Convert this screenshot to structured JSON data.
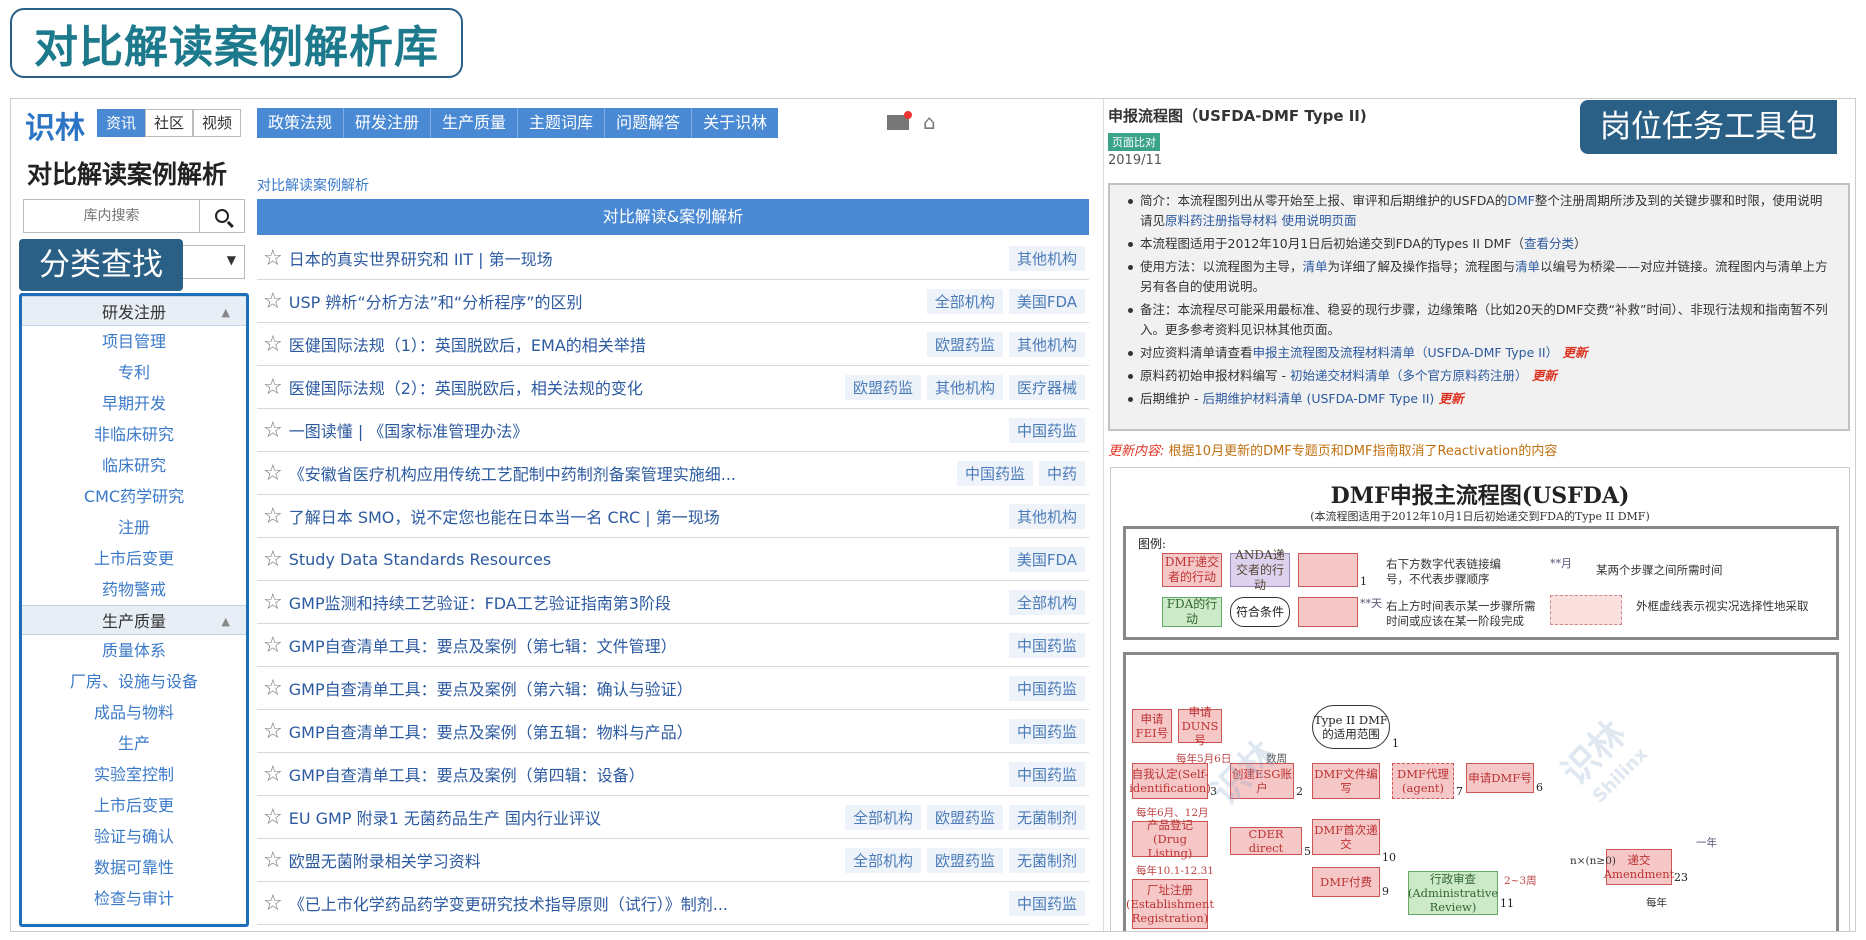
{
  "banner": {
    "title": "对比解读案例解析库"
  },
  "site": {
    "logo": "识林",
    "top_tabs": [
      "资讯",
      "社区",
      "视频"
    ],
    "nav": [
      "政策法规",
      "研发注册",
      "生产质量",
      "主题词库",
      "问题解答",
      "关于识林"
    ]
  },
  "sidebar": {
    "title": "对比解读案例解析",
    "search_placeholder": "库内搜索",
    "tag_label": "分类查找",
    "groups": [
      {
        "title": "研发注册",
        "items": [
          "项目管理",
          "专利",
          "早期开发",
          "非临床研究",
          "临床研究",
          "CMC药学研究",
          "注册",
          "上市后变更",
          "药物警戒"
        ]
      },
      {
        "title": "生产质量",
        "items": [
          "质量体系",
          "厂房、设施与设备",
          "成品与物料",
          "生产",
          "实验室控制",
          "上市后变更",
          "验证与确认",
          "数据可靠性",
          "检查与审计"
        ]
      }
    ]
  },
  "main": {
    "breadcrumb": "对比解读案例解析",
    "header": "对比解读&案例解析",
    "rows": [
      {
        "title": "日本的真实世界研究和 IIT | 第一现场",
        "tags": [
          "其他机构"
        ]
      },
      {
        "title": "USP 辨析“分析方法”和“分析程序”的区别",
        "tags": [
          "全部机构",
          "美国FDA"
        ]
      },
      {
        "title": "医健国际法规（1）：英国脱欧后，EMA的相关举措",
        "tags": [
          "欧盟药监",
          "其他机构"
        ]
      },
      {
        "title": "医健国际法规（2）：英国脱欧后，相关法规的变化",
        "tags": [
          "欧盟药监",
          "其他机构",
          "医疗器械"
        ]
      },
      {
        "title": "一图读懂 | 《国家标准管理办法》",
        "tags": [
          "中国药监"
        ]
      },
      {
        "title": "《安徽省医疗机构应用传统工艺配制中药制剂备案管理实施细...",
        "tags": [
          "中国药监",
          "中药"
        ]
      },
      {
        "title": "了解日本 SMO，说不定您也能在日本当一名 CRC | 第一现场",
        "tags": [
          "其他机构"
        ]
      },
      {
        "title": "Study Data Standards Resources",
        "tags": [
          "美国FDA"
        ]
      },
      {
        "title": "GMP监测和持续工艺验证：FDA工艺验证指南第3阶段",
        "tags": [
          "全部机构"
        ]
      },
      {
        "title": "GMP自查清单工具：要点及案例（第七辑：文件管理）",
        "tags": [
          "中国药监"
        ]
      },
      {
        "title": "GMP自查清单工具：要点及案例（第六辑：确认与验证）",
        "tags": [
          "中国药监"
        ]
      },
      {
        "title": "GMP自查清单工具：要点及案例（第五辑：物料与产品）",
        "tags": [
          "中国药监"
        ]
      },
      {
        "title": "GMP自查清单工具：要点及案例（第四辑：设备）",
        "tags": [
          "中国药监"
        ]
      },
      {
        "title": "EU GMP 附录1 无菌药品生产 国内行业评议",
        "tags": [
          "全部机构",
          "欧盟药监",
          "无菌制剂"
        ]
      },
      {
        "title": "欧盟无菌附录相关学习资料",
        "tags": [
          "全部机构",
          "欧盟药监",
          "无菌制剂"
        ]
      },
      {
        "title": "《已上市化学药品药学变更研究技术指导原则（试行）》制剂...",
        "tags": [
          "中国药监"
        ]
      }
    ]
  },
  "right": {
    "title": "申报流程图（USFDA-DMF Type II)",
    "badge": "页面比对",
    "date": "2019/11",
    "corner_tag": "岗位任务工具包",
    "notes": [
      [
        {
          "t": "简介：本流程图列出从零开始至上报、审评和后期维护的USFDA的"
        },
        {
          "t": "DMF",
          "c": "lk"
        },
        {
          "t": "整个注册周期所涉及到的关键步骤和时限，使用说明请见"
        },
        {
          "t": "原料药注册指导材料 使用说明页面",
          "c": "lk"
        }
      ],
      [
        {
          "t": "本流程图适用于2012年10月1日后初始递交到FDA的Types II DMF（"
        },
        {
          "t": "查看分类",
          "c": "lk"
        },
        {
          "t": "）"
        }
      ],
      [
        {
          "t": "使用方法：以流程图为主导，"
        },
        {
          "t": "清单",
          "c": "lk"
        },
        {
          "t": "为详细了解及操作指导；流程图与"
        },
        {
          "t": "清单",
          "c": "lk"
        },
        {
          "t": "以编号为桥梁——对应并链接。流程图内与清单上方另有各自的使用说明。"
        }
      ],
      [
        {
          "t": "备注：本流程尽可能采用最标准、稳妥的现行步骤，边缘策略（比如20天的DMF交费“补救”时间）、非现行法规和指南暂不列入。更多参考资料见识林其他页面。"
        }
      ],
      [
        {
          "t": "对应资料清单请查看"
        },
        {
          "t": "申报主流程图及流程材料清单（USFDA-DMF Type II）",
          "c": "lk"
        },
        {
          "t": " 更新",
          "c": "new"
        }
      ],
      [
        {
          "t": "原料药初始申报材料编写 - "
        },
        {
          "t": "初始递交材料清单（多个官方原料药注册）",
          "c": "lk"
        },
        {
          "t": " 更新",
          "c": "new"
        }
      ],
      [
        {
          "t": "后期维护 - "
        },
        {
          "t": "后期维护材料清单 (USFDA-DMF Type II)",
          "c": "lk"
        },
        {
          "t": " 更新",
          "c": "new"
        }
      ]
    ],
    "update_key": "更新内容:",
    "update_val": "根据10月更新的DMF专题页和DMF指南取消了Reactivation的内容",
    "flowchart": {
      "title": "DMF申报主流程图(USFDA)",
      "subtitle": "(本流程图适用于2012年10月1日后初始递交到FDA的Type II DMF)",
      "legend_label": "图例:",
      "legend_boxes": [
        "DMF递交者的行动",
        "ANDA递交者的行动",
        "FDA的行动",
        "符合条件"
      ],
      "legend_texts": [
        "右下方数字代表链接编号，不代表步骤顺序",
        "某两个步骤之间所需时间",
        "右上方时间表示某一步骤所需时间或应该在某一阶段完成",
        "外框虚线表示视实况选择性地采取"
      ],
      "legend_marks": [
        "1",
        "**月",
        "**天"
      ],
      "nodes": [
        "申请FEI号",
        "申请DUNS号",
        "Type II DMF的适用范围",
        "自我认定(Self-identification)",
        "创建ESG账户",
        "DMF文件编写",
        "DMF代理(agent)",
        "申请DMF号",
        "产品登记(Drug Listing)",
        "CDER direct",
        "DMF首次递交",
        "DMF付费",
        "行政审查(Administrative Review)",
        "递交Amendment",
        "厂址注册(Establishment Registration)"
      ],
      "notes": [
        "每年5月6日",
        "数周",
        "每年6月、12月",
        "每年10.1-12.31",
        "2~3周",
        "一年",
        "n×(n≥0)",
        "每年"
      ],
      "nums": [
        "1",
        "2",
        "3",
        "4",
        "5",
        "6",
        "7",
        "9",
        "10",
        "11",
        "23"
      ],
      "watermarks": [
        "识林",
        "识林",
        "Shilinx"
      ]
    }
  }
}
